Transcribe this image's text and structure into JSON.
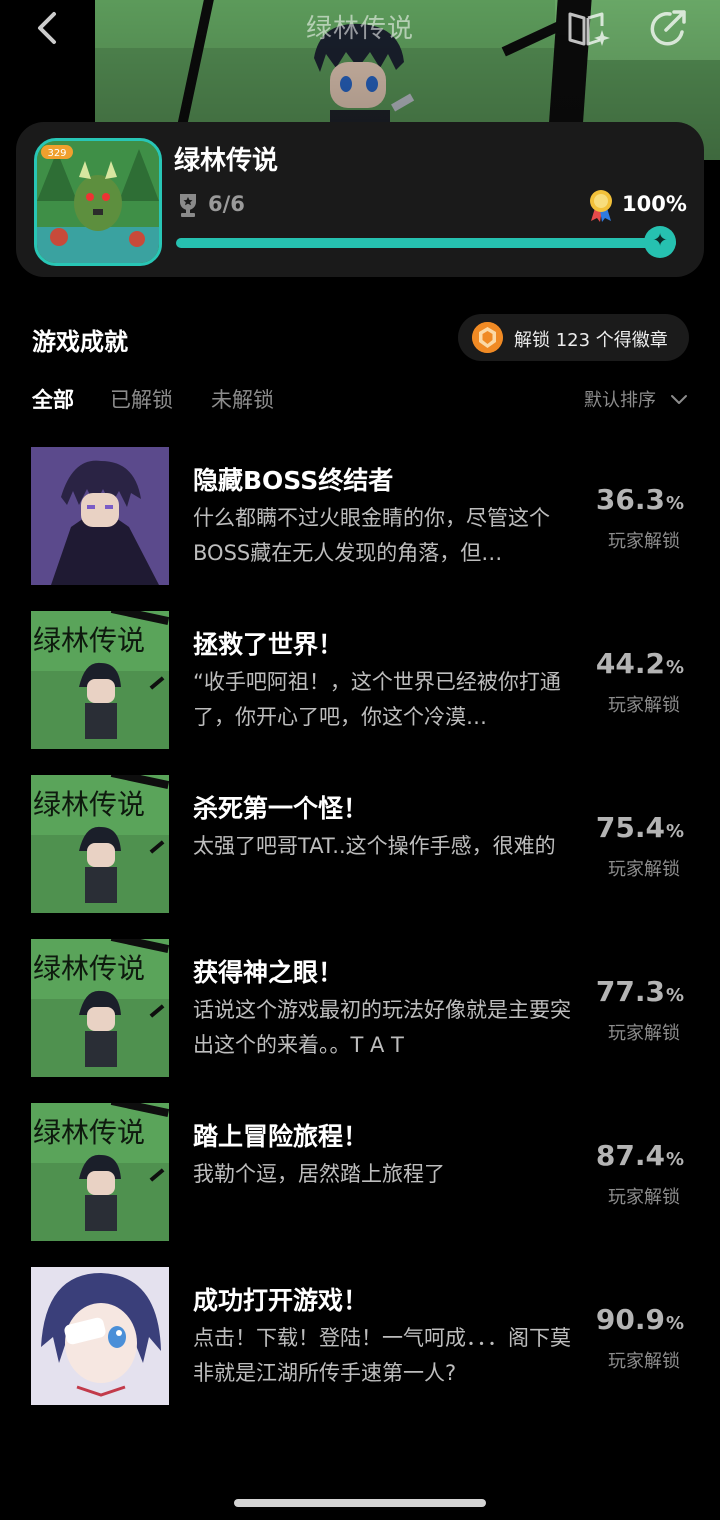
{
  "header": {
    "title": "绿林传说"
  },
  "game_card": {
    "name": "绿林传说",
    "trophy_count": "6/6",
    "completion": "100%",
    "completion_value": 1.0,
    "icon_badge": "329",
    "accent_color": "#26c1b0"
  },
  "section": {
    "title": "游戏成就",
    "badge_text": "解锁 123 个得徽章"
  },
  "tabs": [
    {
      "label": "全部",
      "active": true
    },
    {
      "label": "已解锁",
      "active": false
    },
    {
      "label": "未解锁",
      "active": false
    }
  ],
  "sort": {
    "label": "默认排序"
  },
  "achievements": [
    {
      "title": "隐藏BOSS终结者",
      "desc": "什么都瞒不过火眼金睛的你，尽管这个BOSS藏在无人发现的角落，但…",
      "pct": "36.3",
      "unit": "%",
      "unlock_label": "玩家解锁",
      "thumb": "purple-hero"
    },
    {
      "title": "拯救了世界！",
      "desc": "“收手吧阿祖！，这个世界已经被你打通了，你开心了吧，你这个冷漠…",
      "pct": "44.2",
      "unit": "%",
      "unlock_label": "玩家解锁",
      "thumb": "green-title",
      "thumb_text": "绿林传说"
    },
    {
      "title": "杀死第一个怪！",
      "desc": "太强了吧哥TAT..这个操作手感，很难的",
      "pct": "75.4",
      "unit": "%",
      "unlock_label": "玩家解锁",
      "thumb": "green-title",
      "thumb_text": "绿林传说"
    },
    {
      "title": "获得神之眼！",
      "desc": "话说这个游戏最初的玩法好像就是主要突出这个的来着。。T A T",
      "pct": "77.3",
      "unit": "%",
      "unlock_label": "玩家解锁",
      "thumb": "green-title",
      "thumb_text": "绿林传说"
    },
    {
      "title": "踏上冒险旅程！",
      "desc": "我勒个逗，居然踏上旅程了",
      "pct": "87.4",
      "unit": "%",
      "unlock_label": "玩家解锁",
      "thumb": "green-title",
      "thumb_text": "绿林传说"
    },
    {
      "title": "成功打开游戏！",
      "desc": "点击！下载！登陆！一气呵成．．．阁下莫非就是江湖所传手速第一人?",
      "pct": "90.9",
      "unit": "%",
      "unlock_label": "玩家解锁",
      "thumb": "anime-girl"
    }
  ]
}
